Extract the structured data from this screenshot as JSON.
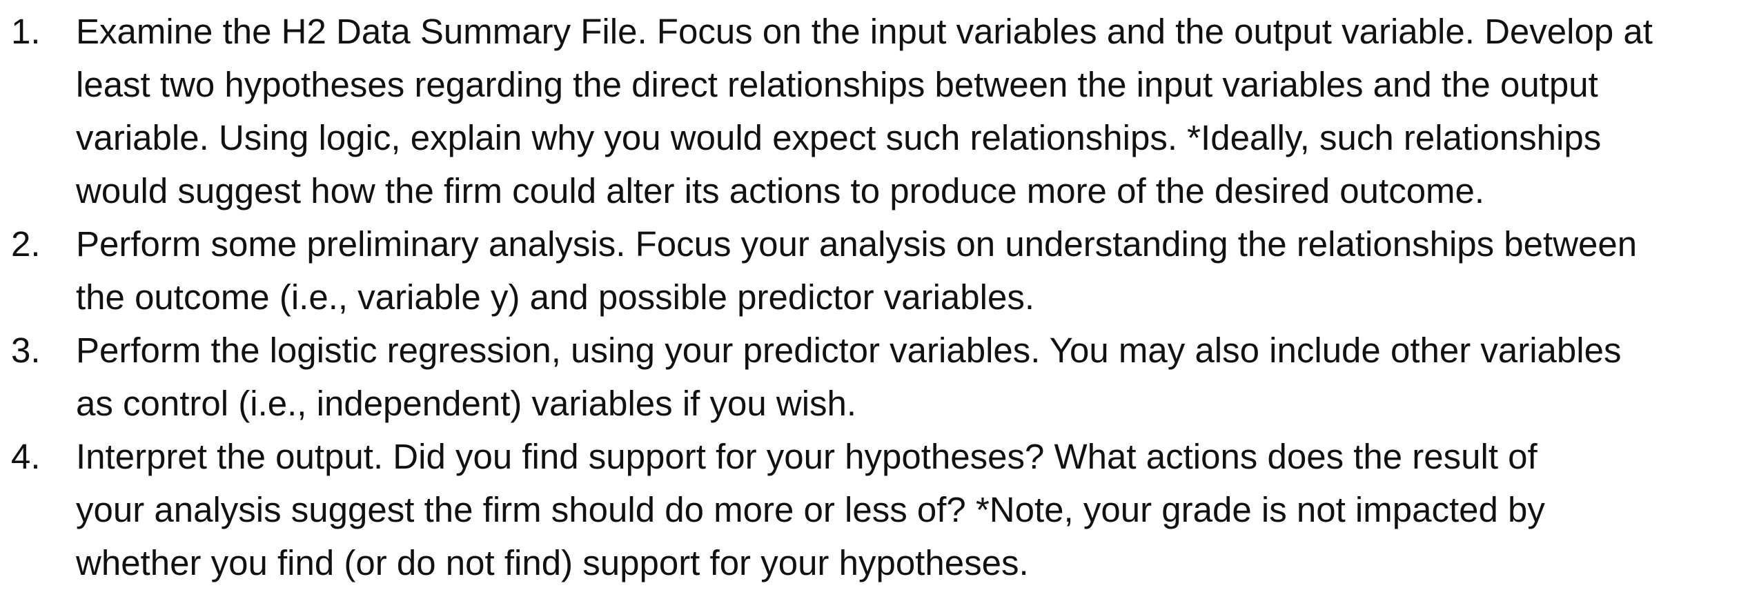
{
  "items": [
    {
      "number": "1.",
      "lines": [
        "Examine the H2 Data Summary File. Focus on the input variables and the output variable. Develop at",
        "least two hypotheses regarding the direct relationships between the input variables and the output",
        "variable. Using logic, explain why you would expect such relationships.  *Ideally, such relationships",
        "would suggest how the firm could alter its actions to produce more of the desired outcome."
      ]
    },
    {
      "number": "2.",
      "lines": [
        "Perform some preliminary analysis. Focus your analysis on understanding the relationships between",
        "the outcome (i.e., variable y) and possible predictor variables."
      ]
    },
    {
      "number": "3.",
      "lines": [
        "Perform the logistic regression, using your predictor variables. You may also include other variables",
        "as control (i.e., independent) variables if you wish."
      ]
    },
    {
      "number": "4.",
      "lines": [
        "Interpret the output. Did you find support for your hypotheses? What actions does the result of",
        "your analysis suggest the firm should do more or less of? *Note, your grade is not impacted by",
        "whether you find (or do not find) support for your hypotheses."
      ]
    }
  ]
}
